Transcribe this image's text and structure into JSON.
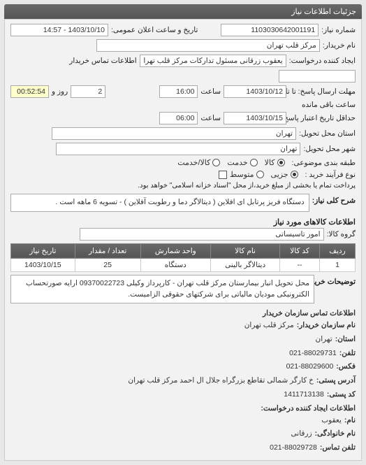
{
  "header": {
    "title": "جزئیات اطلاعات نیاز"
  },
  "fields": {
    "request_no_label": "شماره نیاز:",
    "request_no": "1103030642001191",
    "announce_date_label": "تاریخ و ساعت اعلان عمومی:",
    "announce_date": "1403/10/10 - 14:57",
    "buyer_name_label": "نام خریدار:",
    "buyer_name": "مرکز قلب تهران",
    "creator_label": "ایجاد کننده درخواست:",
    "creator": "یعقوب زرقانی مسئول تدارکات مرکز قلب تهران",
    "buyer_contact_label": "اطلاعات تماس خریدار",
    "deadline_date_label": "مهلت ارسال پاسخ: تا تاریخ:",
    "deadline_date": "1403/10/12",
    "time_label": "ساعت",
    "deadline_time": "16:00",
    "days_left": "2",
    "days_left_label": "روز و",
    "time_left": "00:52:54",
    "time_left_label": "ساعت باقی مانده",
    "min_date_label": "حداقل تاریخ اعتبار پاسخ: تا تاریخ:",
    "min_date": "1403/10/15",
    "min_time": "06:00",
    "province_label": "استان محل تحویل:",
    "province": "تهران",
    "city_label": "شهر محل تحویل:",
    "city": "تهران",
    "class_label": "طبقه بندی موضوعی:",
    "class_opt1": "کالا",
    "class_opt2": "خدمت",
    "class_opt3": "کالا/خدمت",
    "process_label": "نوع فرآیند خرید :",
    "process_opt1": "جزیی",
    "process_opt2": "متوسط",
    "process_note": "پرداخت تمام یا بخشی از مبلغ خرید،از محل \"اسناد خزانه اسلامی\" خواهد بود.",
    "overall_desc_label": "شرح کلی نیاز:",
    "overall_desc": "دستگاه فریز پرتابل ای افلاین ( دیتالاگر دما و رطوبت آفلاین ) - تسویه 6 ماهه است .",
    "goods_header": "اطلاعات کالاهای مورد نیاز",
    "goods_group_label": "گروه کالا:",
    "goods_group": "امور تاسیساتی"
  },
  "table": {
    "headers": {
      "row": "ردیف",
      "code": "کد کالا",
      "name": "نام کالا",
      "unit": "واحد شمارش",
      "qty": "تعداد / مقدار",
      "need_date": "تاریخ نیاز"
    },
    "rows": [
      {
        "row": "1",
        "code": "--",
        "name": "دیتالاگر بالینی",
        "unit": "دستگاه",
        "qty": "25",
        "need_date": "1403/10/15"
      }
    ]
  },
  "buyer_note": {
    "label": "توضیحات خریدار:",
    "text": "محل تحویل انبار بیمارستان مرکز قلب تهران - کارپرداز وکیلی 09370022723 ارایه صورتحساب الکترونیکی مودیان مالیاتی برای شرکتهای حقوقی الزامیست."
  },
  "contact": {
    "header": "اطلاعات تماس سازمان خریدار",
    "org_label": "نام سازمان خریدار:",
    "org": "مرکز قلب تهران",
    "prov_label": "استان:",
    "prov": "تهران",
    "tel_label": "تلفن:",
    "tel": "021-88029731",
    "fax_label": "فکس:",
    "fax": "021-88029600",
    "addr_label": "آدرس پستی:",
    "addr": "خ کارگر شمالی تقاطع بزرگراه جلال ال احمد مرکز قلب تهران",
    "zip_label": "کد پستی:",
    "zip": "1411713138",
    "creator_header": "اطلاعات ایجاد کننده درخواست:",
    "name_label": "نام:",
    "name": "یعقوب",
    "fam_label": "نام خانوادگی:",
    "fam": "زرقانی",
    "ctel_label": "تلفن تماس:",
    "ctel": "021-88029728"
  }
}
